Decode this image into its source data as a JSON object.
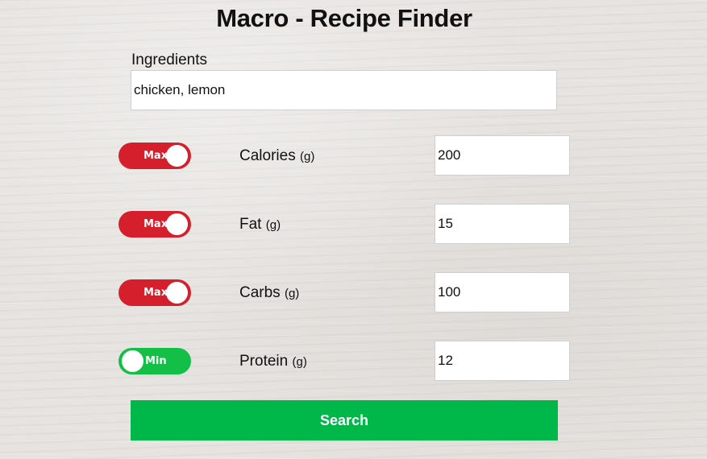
{
  "app": {
    "title": "Macro - Recipe Finder"
  },
  "ingredients": {
    "label": "Ingredients",
    "value": "chicken, lemon"
  },
  "macros": [
    {
      "name": "Calories",
      "unit": "(g)",
      "mode": "Max",
      "value": "200"
    },
    {
      "name": "Fat",
      "unit": "(g)",
      "mode": "Max",
      "value": "15"
    },
    {
      "name": "Carbs",
      "unit": "(g)",
      "mode": "Max",
      "value": "100"
    },
    {
      "name": "Protein",
      "unit": "(g)",
      "mode": "Min",
      "value": "12"
    }
  ],
  "search": {
    "label": "Search"
  },
  "colors": {
    "max_toggle": "#d61f2c",
    "min_toggle": "#14bf47",
    "search_button": "#00b84a"
  }
}
